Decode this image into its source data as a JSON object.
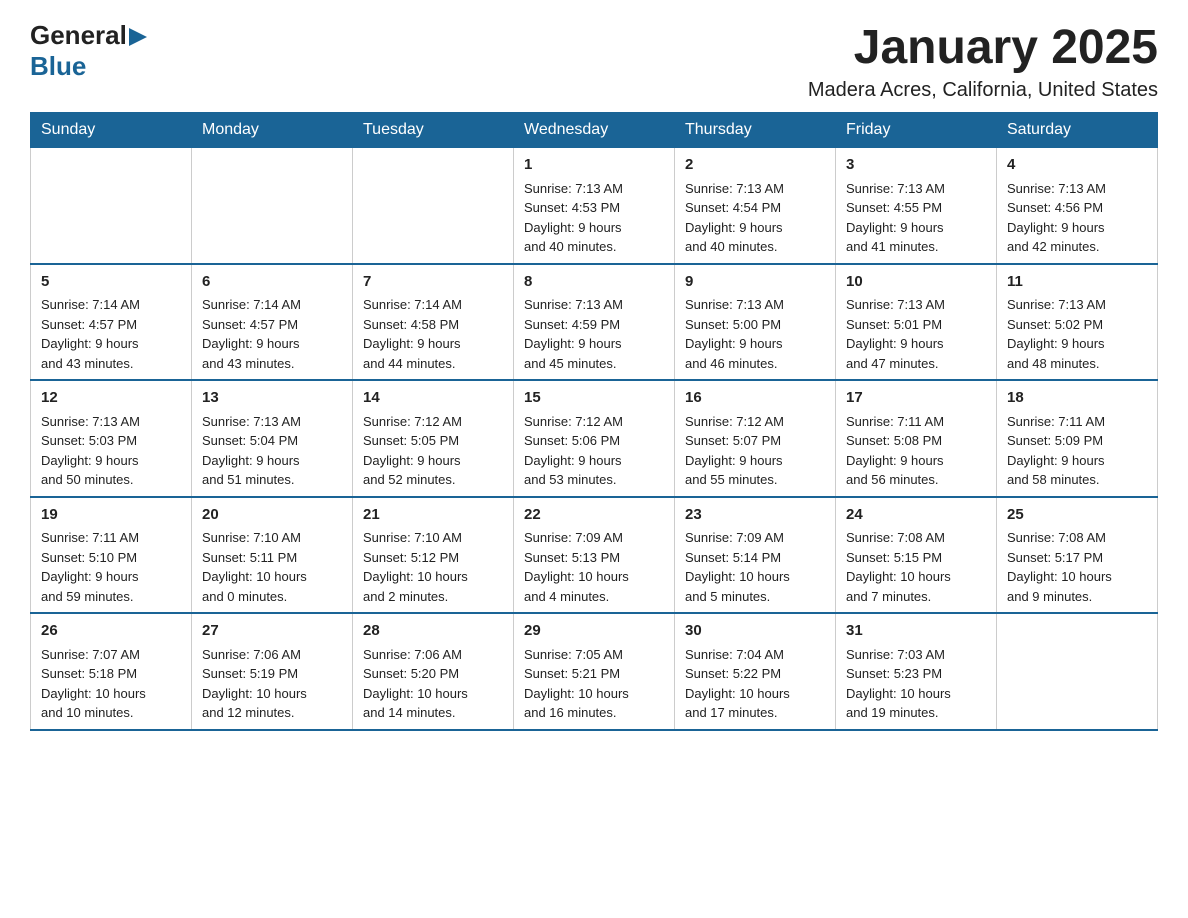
{
  "logo": {
    "general": "General",
    "blue": "Blue"
  },
  "title": "January 2025",
  "subtitle": "Madera Acres, California, United States",
  "weekdays": [
    "Sunday",
    "Monday",
    "Tuesday",
    "Wednesday",
    "Thursday",
    "Friday",
    "Saturday"
  ],
  "weeks": [
    [
      {
        "day": "",
        "info": ""
      },
      {
        "day": "",
        "info": ""
      },
      {
        "day": "",
        "info": ""
      },
      {
        "day": "1",
        "info": "Sunrise: 7:13 AM\nSunset: 4:53 PM\nDaylight: 9 hours\nand 40 minutes."
      },
      {
        "day": "2",
        "info": "Sunrise: 7:13 AM\nSunset: 4:54 PM\nDaylight: 9 hours\nand 40 minutes."
      },
      {
        "day": "3",
        "info": "Sunrise: 7:13 AM\nSunset: 4:55 PM\nDaylight: 9 hours\nand 41 minutes."
      },
      {
        "day": "4",
        "info": "Sunrise: 7:13 AM\nSunset: 4:56 PM\nDaylight: 9 hours\nand 42 minutes."
      }
    ],
    [
      {
        "day": "5",
        "info": "Sunrise: 7:14 AM\nSunset: 4:57 PM\nDaylight: 9 hours\nand 43 minutes."
      },
      {
        "day": "6",
        "info": "Sunrise: 7:14 AM\nSunset: 4:57 PM\nDaylight: 9 hours\nand 43 minutes."
      },
      {
        "day": "7",
        "info": "Sunrise: 7:14 AM\nSunset: 4:58 PM\nDaylight: 9 hours\nand 44 minutes."
      },
      {
        "day": "8",
        "info": "Sunrise: 7:13 AM\nSunset: 4:59 PM\nDaylight: 9 hours\nand 45 minutes."
      },
      {
        "day": "9",
        "info": "Sunrise: 7:13 AM\nSunset: 5:00 PM\nDaylight: 9 hours\nand 46 minutes."
      },
      {
        "day": "10",
        "info": "Sunrise: 7:13 AM\nSunset: 5:01 PM\nDaylight: 9 hours\nand 47 minutes."
      },
      {
        "day": "11",
        "info": "Sunrise: 7:13 AM\nSunset: 5:02 PM\nDaylight: 9 hours\nand 48 minutes."
      }
    ],
    [
      {
        "day": "12",
        "info": "Sunrise: 7:13 AM\nSunset: 5:03 PM\nDaylight: 9 hours\nand 50 minutes."
      },
      {
        "day": "13",
        "info": "Sunrise: 7:13 AM\nSunset: 5:04 PM\nDaylight: 9 hours\nand 51 minutes."
      },
      {
        "day": "14",
        "info": "Sunrise: 7:12 AM\nSunset: 5:05 PM\nDaylight: 9 hours\nand 52 minutes."
      },
      {
        "day": "15",
        "info": "Sunrise: 7:12 AM\nSunset: 5:06 PM\nDaylight: 9 hours\nand 53 minutes."
      },
      {
        "day": "16",
        "info": "Sunrise: 7:12 AM\nSunset: 5:07 PM\nDaylight: 9 hours\nand 55 minutes."
      },
      {
        "day": "17",
        "info": "Sunrise: 7:11 AM\nSunset: 5:08 PM\nDaylight: 9 hours\nand 56 minutes."
      },
      {
        "day": "18",
        "info": "Sunrise: 7:11 AM\nSunset: 5:09 PM\nDaylight: 9 hours\nand 58 minutes."
      }
    ],
    [
      {
        "day": "19",
        "info": "Sunrise: 7:11 AM\nSunset: 5:10 PM\nDaylight: 9 hours\nand 59 minutes."
      },
      {
        "day": "20",
        "info": "Sunrise: 7:10 AM\nSunset: 5:11 PM\nDaylight: 10 hours\nand 0 minutes."
      },
      {
        "day": "21",
        "info": "Sunrise: 7:10 AM\nSunset: 5:12 PM\nDaylight: 10 hours\nand 2 minutes."
      },
      {
        "day": "22",
        "info": "Sunrise: 7:09 AM\nSunset: 5:13 PM\nDaylight: 10 hours\nand 4 minutes."
      },
      {
        "day": "23",
        "info": "Sunrise: 7:09 AM\nSunset: 5:14 PM\nDaylight: 10 hours\nand 5 minutes."
      },
      {
        "day": "24",
        "info": "Sunrise: 7:08 AM\nSunset: 5:15 PM\nDaylight: 10 hours\nand 7 minutes."
      },
      {
        "day": "25",
        "info": "Sunrise: 7:08 AM\nSunset: 5:17 PM\nDaylight: 10 hours\nand 9 minutes."
      }
    ],
    [
      {
        "day": "26",
        "info": "Sunrise: 7:07 AM\nSunset: 5:18 PM\nDaylight: 10 hours\nand 10 minutes."
      },
      {
        "day": "27",
        "info": "Sunrise: 7:06 AM\nSunset: 5:19 PM\nDaylight: 10 hours\nand 12 minutes."
      },
      {
        "day": "28",
        "info": "Sunrise: 7:06 AM\nSunset: 5:20 PM\nDaylight: 10 hours\nand 14 minutes."
      },
      {
        "day": "29",
        "info": "Sunrise: 7:05 AM\nSunset: 5:21 PM\nDaylight: 10 hours\nand 16 minutes."
      },
      {
        "day": "30",
        "info": "Sunrise: 7:04 AM\nSunset: 5:22 PM\nDaylight: 10 hours\nand 17 minutes."
      },
      {
        "day": "31",
        "info": "Sunrise: 7:03 AM\nSunset: 5:23 PM\nDaylight: 10 hours\nand 19 minutes."
      },
      {
        "day": "",
        "info": ""
      }
    ]
  ]
}
